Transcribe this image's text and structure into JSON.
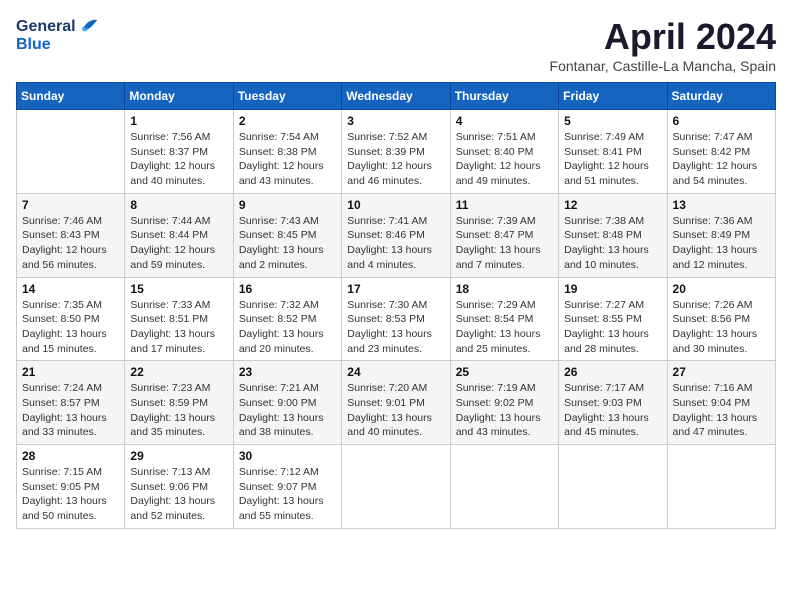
{
  "header": {
    "logo_line1": "General",
    "logo_line2": "Blue",
    "month_title": "April 2024",
    "location": "Fontanar, Castille-La Mancha, Spain"
  },
  "days_of_week": [
    "Sunday",
    "Monday",
    "Tuesday",
    "Wednesday",
    "Thursday",
    "Friday",
    "Saturday"
  ],
  "weeks": [
    [
      {
        "day": "",
        "sunrise": "",
        "sunset": "",
        "daylight": ""
      },
      {
        "day": "1",
        "sunrise": "Sunrise: 7:56 AM",
        "sunset": "Sunset: 8:37 PM",
        "daylight": "Daylight: 12 hours and 40 minutes."
      },
      {
        "day": "2",
        "sunrise": "Sunrise: 7:54 AM",
        "sunset": "Sunset: 8:38 PM",
        "daylight": "Daylight: 12 hours and 43 minutes."
      },
      {
        "day": "3",
        "sunrise": "Sunrise: 7:52 AM",
        "sunset": "Sunset: 8:39 PM",
        "daylight": "Daylight: 12 hours and 46 minutes."
      },
      {
        "day": "4",
        "sunrise": "Sunrise: 7:51 AM",
        "sunset": "Sunset: 8:40 PM",
        "daylight": "Daylight: 12 hours and 49 minutes."
      },
      {
        "day": "5",
        "sunrise": "Sunrise: 7:49 AM",
        "sunset": "Sunset: 8:41 PM",
        "daylight": "Daylight: 12 hours and 51 minutes."
      },
      {
        "day": "6",
        "sunrise": "Sunrise: 7:47 AM",
        "sunset": "Sunset: 8:42 PM",
        "daylight": "Daylight: 12 hours and 54 minutes."
      }
    ],
    [
      {
        "day": "7",
        "sunrise": "Sunrise: 7:46 AM",
        "sunset": "Sunset: 8:43 PM",
        "daylight": "Daylight: 12 hours and 56 minutes."
      },
      {
        "day": "8",
        "sunrise": "Sunrise: 7:44 AM",
        "sunset": "Sunset: 8:44 PM",
        "daylight": "Daylight: 12 hours and 59 minutes."
      },
      {
        "day": "9",
        "sunrise": "Sunrise: 7:43 AM",
        "sunset": "Sunset: 8:45 PM",
        "daylight": "Daylight: 13 hours and 2 minutes."
      },
      {
        "day": "10",
        "sunrise": "Sunrise: 7:41 AM",
        "sunset": "Sunset: 8:46 PM",
        "daylight": "Daylight: 13 hours and 4 minutes."
      },
      {
        "day": "11",
        "sunrise": "Sunrise: 7:39 AM",
        "sunset": "Sunset: 8:47 PM",
        "daylight": "Daylight: 13 hours and 7 minutes."
      },
      {
        "day": "12",
        "sunrise": "Sunrise: 7:38 AM",
        "sunset": "Sunset: 8:48 PM",
        "daylight": "Daylight: 13 hours and 10 minutes."
      },
      {
        "day": "13",
        "sunrise": "Sunrise: 7:36 AM",
        "sunset": "Sunset: 8:49 PM",
        "daylight": "Daylight: 13 hours and 12 minutes."
      }
    ],
    [
      {
        "day": "14",
        "sunrise": "Sunrise: 7:35 AM",
        "sunset": "Sunset: 8:50 PM",
        "daylight": "Daylight: 13 hours and 15 minutes."
      },
      {
        "day": "15",
        "sunrise": "Sunrise: 7:33 AM",
        "sunset": "Sunset: 8:51 PM",
        "daylight": "Daylight: 13 hours and 17 minutes."
      },
      {
        "day": "16",
        "sunrise": "Sunrise: 7:32 AM",
        "sunset": "Sunset: 8:52 PM",
        "daylight": "Daylight: 13 hours and 20 minutes."
      },
      {
        "day": "17",
        "sunrise": "Sunrise: 7:30 AM",
        "sunset": "Sunset: 8:53 PM",
        "daylight": "Daylight: 13 hours and 23 minutes."
      },
      {
        "day": "18",
        "sunrise": "Sunrise: 7:29 AM",
        "sunset": "Sunset: 8:54 PM",
        "daylight": "Daylight: 13 hours and 25 minutes."
      },
      {
        "day": "19",
        "sunrise": "Sunrise: 7:27 AM",
        "sunset": "Sunset: 8:55 PM",
        "daylight": "Daylight: 13 hours and 28 minutes."
      },
      {
        "day": "20",
        "sunrise": "Sunrise: 7:26 AM",
        "sunset": "Sunset: 8:56 PM",
        "daylight": "Daylight: 13 hours and 30 minutes."
      }
    ],
    [
      {
        "day": "21",
        "sunrise": "Sunrise: 7:24 AM",
        "sunset": "Sunset: 8:57 PM",
        "daylight": "Daylight: 13 hours and 33 minutes."
      },
      {
        "day": "22",
        "sunrise": "Sunrise: 7:23 AM",
        "sunset": "Sunset: 8:59 PM",
        "daylight": "Daylight: 13 hours and 35 minutes."
      },
      {
        "day": "23",
        "sunrise": "Sunrise: 7:21 AM",
        "sunset": "Sunset: 9:00 PM",
        "daylight": "Daylight: 13 hours and 38 minutes."
      },
      {
        "day": "24",
        "sunrise": "Sunrise: 7:20 AM",
        "sunset": "Sunset: 9:01 PM",
        "daylight": "Daylight: 13 hours and 40 minutes."
      },
      {
        "day": "25",
        "sunrise": "Sunrise: 7:19 AM",
        "sunset": "Sunset: 9:02 PM",
        "daylight": "Daylight: 13 hours and 43 minutes."
      },
      {
        "day": "26",
        "sunrise": "Sunrise: 7:17 AM",
        "sunset": "Sunset: 9:03 PM",
        "daylight": "Daylight: 13 hours and 45 minutes."
      },
      {
        "day": "27",
        "sunrise": "Sunrise: 7:16 AM",
        "sunset": "Sunset: 9:04 PM",
        "daylight": "Daylight: 13 hours and 47 minutes."
      }
    ],
    [
      {
        "day": "28",
        "sunrise": "Sunrise: 7:15 AM",
        "sunset": "Sunset: 9:05 PM",
        "daylight": "Daylight: 13 hours and 50 minutes."
      },
      {
        "day": "29",
        "sunrise": "Sunrise: 7:13 AM",
        "sunset": "Sunset: 9:06 PM",
        "daylight": "Daylight: 13 hours and 52 minutes."
      },
      {
        "day": "30",
        "sunrise": "Sunrise: 7:12 AM",
        "sunset": "Sunset: 9:07 PM",
        "daylight": "Daylight: 13 hours and 55 minutes."
      },
      {
        "day": "",
        "sunrise": "",
        "sunset": "",
        "daylight": ""
      },
      {
        "day": "",
        "sunrise": "",
        "sunset": "",
        "daylight": ""
      },
      {
        "day": "",
        "sunrise": "",
        "sunset": "",
        "daylight": ""
      },
      {
        "day": "",
        "sunrise": "",
        "sunset": "",
        "daylight": ""
      }
    ]
  ]
}
